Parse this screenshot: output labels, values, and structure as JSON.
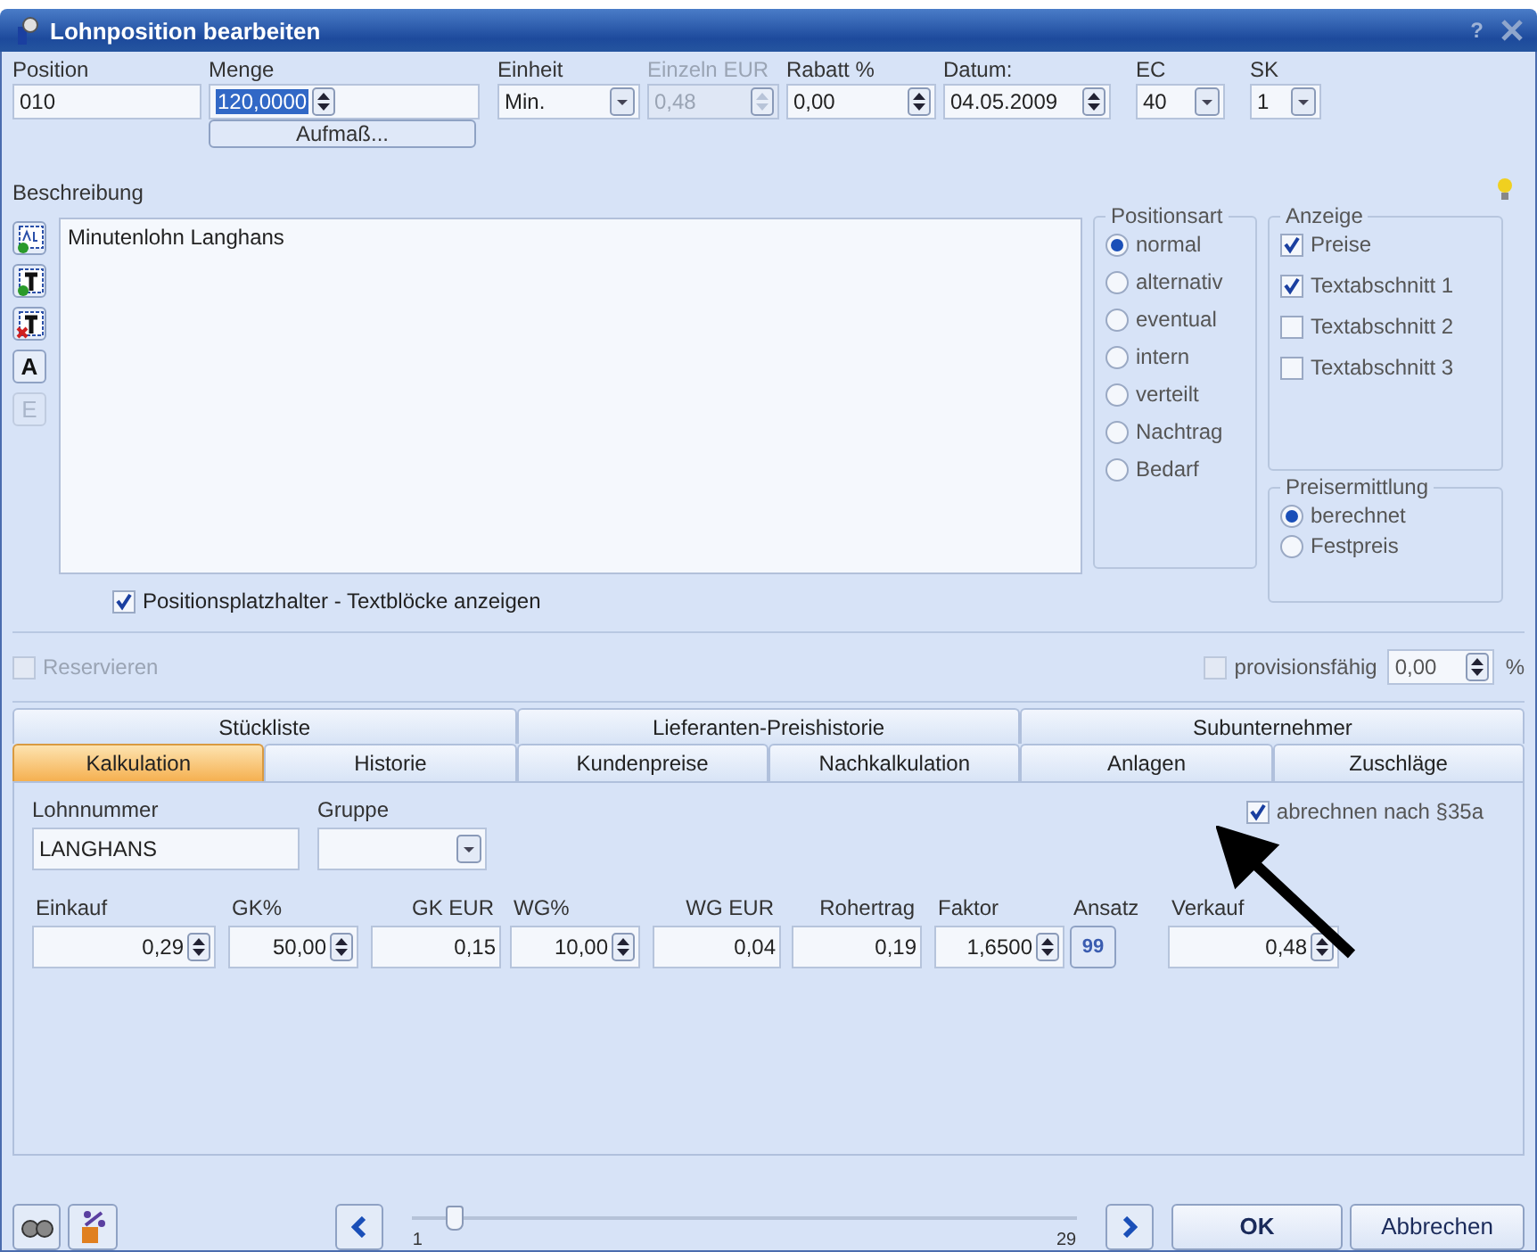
{
  "window": {
    "title": "Lohnposition bearbeiten",
    "help": "?"
  },
  "header_fields": [
    {
      "label": "Position",
      "value": "010",
      "kind": "text",
      "disabled": false,
      "selected": false
    },
    {
      "label": "Menge",
      "value": "120,0000",
      "kind": "spin",
      "disabled": false,
      "selected": true,
      "sub_button": "Aufmaß..."
    },
    {
      "label": "Einheit",
      "value": "Min.",
      "kind": "combo",
      "disabled": false,
      "selected": false
    },
    {
      "label": "Einzeln EUR",
      "value": "0,48",
      "kind": "spin",
      "disabled": true,
      "selected": false
    },
    {
      "label": "Rabatt %",
      "value": "0,00",
      "kind": "spin",
      "disabled": false,
      "selected": false
    },
    {
      "label": "Datum:",
      "value": "04.05.2009",
      "kind": "spin",
      "disabled": false,
      "selected": false
    },
    {
      "label": "EC",
      "value": "40",
      "kind": "combo",
      "disabled": false,
      "selected": false
    },
    {
      "label": "SK",
      "value": "1",
      "kind": "combo",
      "disabled": false,
      "selected": false
    }
  ],
  "description": {
    "label": "Beschreibung",
    "text": "Minutenlohn Langhans"
  },
  "tools": [
    {
      "kind": "abc_add",
      "disabled": false
    },
    {
      "kind": "text_add",
      "disabled": false
    },
    {
      "kind": "text_delete",
      "disabled": false
    },
    {
      "kind": "letter",
      "label": "A",
      "disabled": false
    },
    {
      "kind": "letter",
      "label": "E",
      "disabled": true
    }
  ],
  "placeholder_checkbox": {
    "label": "Positionsplatzhalter - Textblöcke anzeigen",
    "checked": true
  },
  "positionsart": {
    "title": "Positionsart",
    "options": [
      {
        "label": "normal",
        "selected": true
      },
      {
        "label": "alternativ",
        "selected": false
      },
      {
        "label": "eventual",
        "selected": false
      },
      {
        "label": "intern",
        "selected": false
      },
      {
        "label": "verteilt",
        "selected": false
      },
      {
        "label": "Nachtrag",
        "selected": false
      },
      {
        "label": "Bedarf",
        "selected": false
      }
    ]
  },
  "anzeige": {
    "title": "Anzeige",
    "items": [
      {
        "label": "Preise",
        "checked": true
      },
      {
        "label": "Textabschnitt 1",
        "checked": true
      },
      {
        "label": "Textabschnitt 2",
        "checked": false
      },
      {
        "label": "Textabschnitt 3",
        "checked": false
      }
    ]
  },
  "preisermittlung": {
    "title": "Preisermittlung",
    "options": [
      {
        "label": "berechnet",
        "selected": true
      },
      {
        "label": "Festpreis",
        "selected": false
      }
    ]
  },
  "reservieren": {
    "label": "Reservieren",
    "checked": false,
    "disabled": true
  },
  "provision": {
    "label": "provisionsfähig",
    "checked": false,
    "value": "0,00",
    "unit": "%"
  },
  "tabs_row1": [
    {
      "label": "Stückliste",
      "selected": false
    },
    {
      "label": "Lieferanten-Preishistorie",
      "selected": false
    },
    {
      "label": "Subunternehmer",
      "selected": false
    }
  ],
  "tabs_row2": [
    {
      "label": "Kalkulation",
      "selected": true
    },
    {
      "label": "Historie",
      "selected": false
    },
    {
      "label": "Kundenpreise",
      "selected": false
    },
    {
      "label": "Nachkalkulation",
      "selected": false
    },
    {
      "label": "Anlagen",
      "selected": false
    },
    {
      "label": "Zuschläge",
      "selected": false
    }
  ],
  "kalkulation": {
    "lohnnummer_label": "Lohnnummer",
    "lohnnummer": "LANGHANS",
    "gruppe_label": "Gruppe",
    "abrechnen": {
      "label": "abrechnen nach §35a",
      "checked": true
    },
    "fields": [
      {
        "label": "Einkauf",
        "value": "0,29",
        "kind": "spin"
      },
      {
        "label": "GK%",
        "value": "50,00",
        "kind": "spin"
      },
      {
        "label": "GK EUR",
        "value": "0,15",
        "kind": "text"
      },
      {
        "label": "WG%",
        "value": "10,00",
        "kind": "spin"
      },
      {
        "label": "WG EUR",
        "value": "0,04",
        "kind": "text"
      },
      {
        "label": "Rohertrag",
        "value": "0,19",
        "kind": "text"
      },
      {
        "label": "Faktor",
        "value": "1,6500",
        "kind": "spin"
      },
      {
        "label": "Ansatz",
        "value": "99",
        "kind": "button"
      },
      {
        "label": "Verkauf",
        "value": "0,48",
        "kind": "spin"
      }
    ]
  },
  "footer": {
    "slider": {
      "min": "1",
      "max": "29",
      "level": 0.05
    },
    "ok": "OK",
    "cancel": "Abbrechen"
  }
}
